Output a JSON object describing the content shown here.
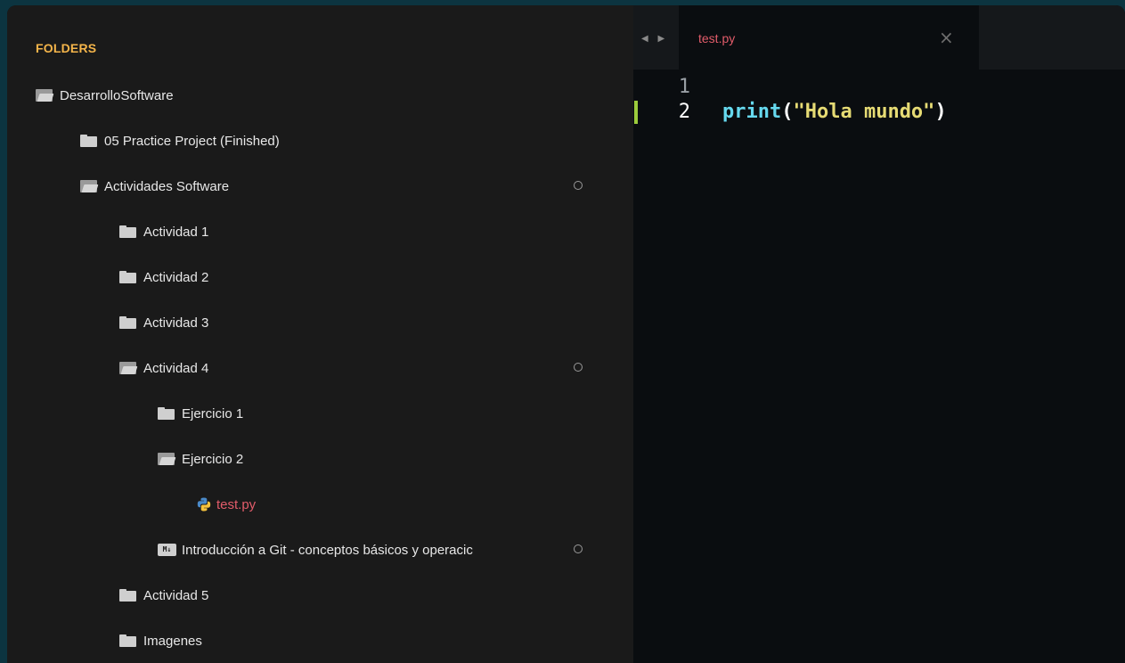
{
  "sidebar": {
    "header": "FOLDERS",
    "items": [
      {
        "label": "DesarrolloSoftware",
        "icon": "folder-open-icon"
      },
      {
        "label": "05 Practice Project (Finished)",
        "icon": "folder-icon"
      },
      {
        "label": "Actividades Software",
        "icon": "folder-open-icon",
        "modified": true
      },
      {
        "label": "Actividad 1",
        "icon": "folder-icon"
      },
      {
        "label": "Actividad 2",
        "icon": "folder-icon"
      },
      {
        "label": "Actividad 3",
        "icon": "folder-icon"
      },
      {
        "label": "Actividad 4",
        "icon": "folder-open-icon",
        "modified": true
      },
      {
        "label": "Ejercicio 1",
        "icon": "folder-icon"
      },
      {
        "label": "Ejercicio 2",
        "icon": "folder-open-icon"
      },
      {
        "label": "test.py",
        "icon": "python-file-icon",
        "active": true
      },
      {
        "label": "Introducción a Git - conceptos básicos y operacic",
        "icon": "markdown-file-icon",
        "modified": true
      },
      {
        "label": "Actividad 5",
        "icon": "folder-icon"
      },
      {
        "label": "Imagenes",
        "icon": "folder-icon"
      }
    ]
  },
  "editor": {
    "tab_label": "test.py",
    "tab_close": "×",
    "nav_arrows": "◀ ▶",
    "lines": [
      {
        "number": "1",
        "code": ""
      },
      {
        "number": "2",
        "func": "print",
        "open": "(",
        "string": "\"Hola mundo\"",
        "close": ")"
      }
    ]
  },
  "colors": {
    "sidebar_header": "#f5b54a",
    "active_file": "#e25c6a",
    "function": "#66d9ef",
    "string": "#e6db74",
    "line_marker": "#9ccc3c"
  }
}
